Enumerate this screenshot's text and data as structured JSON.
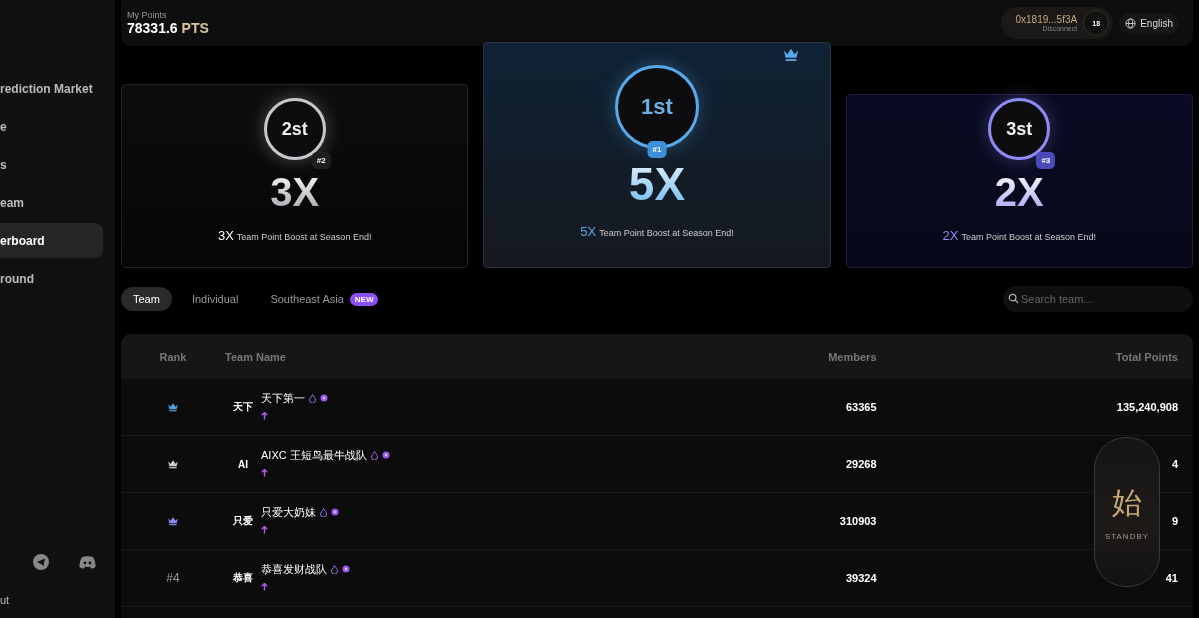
{
  "sidebar": {
    "items": [
      {
        "label": "rediction Market",
        "selected": false
      },
      {
        "label": "e",
        "selected": false
      },
      {
        "label": "s",
        "selected": false
      },
      {
        "label": "eam",
        "selected": false
      },
      {
        "label": "erboard",
        "selected": true
      },
      {
        "label": "round",
        "selected": false
      }
    ],
    "footer_link": "ut"
  },
  "header": {
    "points_label": "My Points",
    "points_value": "78331.6",
    "points_unit": "PTS",
    "wallet_address": "0x1819...5f3A",
    "disconnect": "Disconnect",
    "level_badge": "18",
    "language": "English"
  },
  "podium": [
    {
      "kind": "second",
      "rank": "2st",
      "badge": "#2",
      "multiplier": "3X",
      "boost_prefix": "3X",
      "boost_text": "Team Point Boost at Season End!"
    },
    {
      "kind": "first",
      "rank": "1st",
      "badge": "#1",
      "multiplier": "5X",
      "boost_prefix": "5X",
      "boost_text": "Team Point Boost at Season End!"
    },
    {
      "kind": "third",
      "rank": "3st",
      "badge": "#3",
      "multiplier": "2X",
      "boost_prefix": "2X",
      "boost_text": "Team Point Boost at Season End!"
    }
  ],
  "tabs": [
    {
      "label": "Team",
      "selected": true
    },
    {
      "label": "Individual",
      "selected": false
    },
    {
      "label": "Southeast Asia",
      "selected": false,
      "badge": "NEW"
    }
  ],
  "search": {
    "placeholder": "Search team..."
  },
  "table": {
    "columns": [
      "Rank",
      "Team Name",
      "Members",
      "Total Points"
    ],
    "rows": [
      {
        "color": "#4fa3e0",
        "avatar": "天下",
        "name": "天下第一",
        "members": "63365",
        "total_points": "135,240,908"
      },
      {
        "color": "#d0d0d0",
        "avatar": "AI",
        "name": "AIXC 王短鸟最牛战队",
        "members": "29268",
        "total_points": "4"
      },
      {
        "color": "#8c8cf2",
        "avatar": "只爱",
        "name": "只爱大奶妹",
        "members": "310903",
        "total_points": "9"
      },
      {
        "rank": "#4",
        "avatar": "恭喜",
        "name": "恭喜发财战队",
        "members": "39324",
        "total_points": "41"
      }
    ]
  },
  "widget": {
    "character": "始",
    "status": "STANDBY"
  }
}
